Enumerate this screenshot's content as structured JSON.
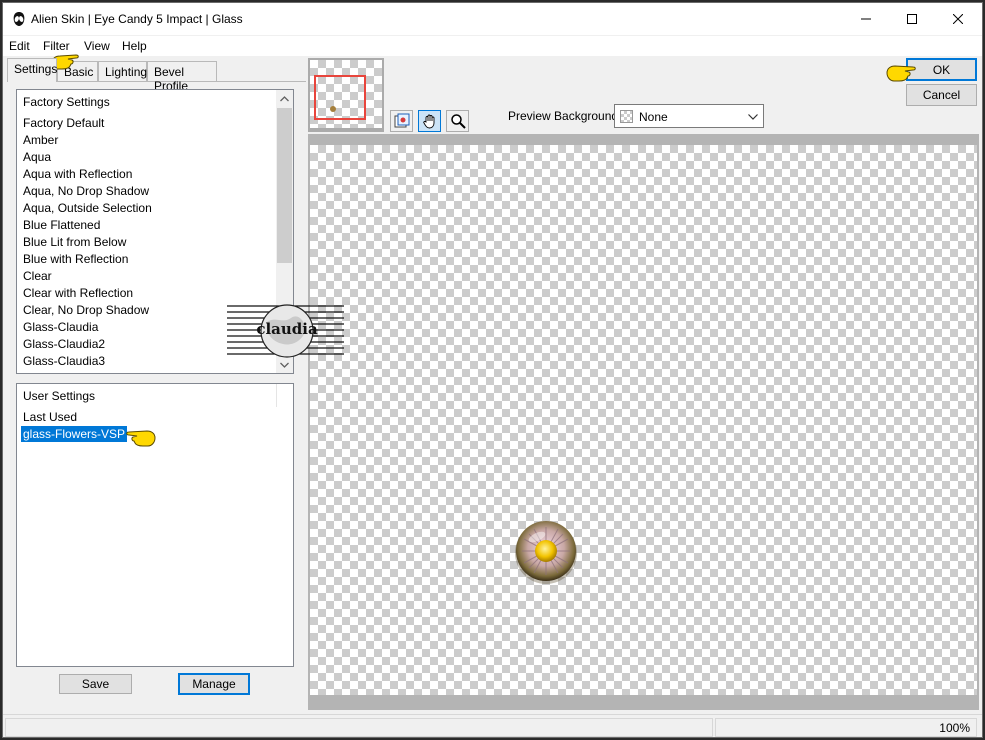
{
  "window": {
    "title": "Alien Skin | Eye Candy 5 Impact | Glass"
  },
  "menu": {
    "items": [
      "Edit",
      "Filter",
      "View",
      "Help"
    ]
  },
  "tabs": [
    {
      "label": "Settings",
      "active": true
    },
    {
      "label": "Basic",
      "active": false
    },
    {
      "label": "Lighting",
      "active": false
    },
    {
      "label": "Bevel Profile",
      "active": false
    }
  ],
  "factory_settings": {
    "header": "Factory Settings",
    "items": [
      "Factory Default",
      "Amber",
      "Aqua",
      "Aqua with Reflection",
      "Aqua, No Drop Shadow",
      "Aqua, Outside Selection",
      "Blue Flattened",
      "Blue Lit from Below",
      "Blue with Reflection",
      "Clear",
      "Clear with Reflection",
      "Clear, No Drop Shadow",
      "Glass-Claudia",
      "Glass-Claudia2",
      "Glass-Claudia3"
    ]
  },
  "user_settings": {
    "header": "User Settings",
    "items": [
      "Last Used",
      "glass-Flowers-VSP"
    ],
    "selected": "glass-Flowers-VSP"
  },
  "buttons": {
    "save": "Save",
    "manage": "Manage",
    "ok": "OK",
    "cancel": "Cancel"
  },
  "preview": {
    "background_label": "Preview Background:",
    "background_value": "None"
  },
  "status": {
    "zoom": "100%"
  },
  "watermark": {
    "text": "claudia"
  },
  "colors": {
    "selection": "#0078d7",
    "pointer": "#ffd800",
    "thumb_view_border": "#e8453c"
  }
}
